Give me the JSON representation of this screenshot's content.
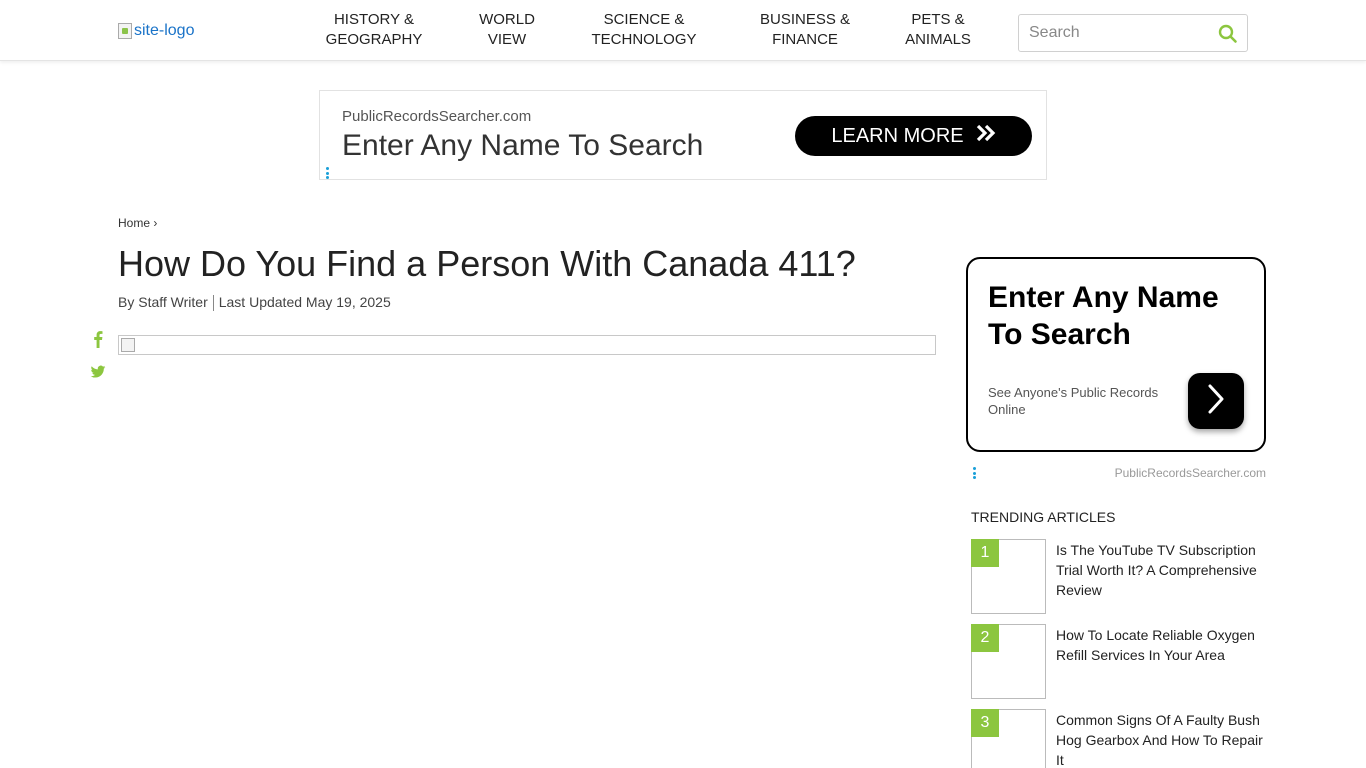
{
  "header": {
    "logo_alt": "site-logo",
    "nav": [
      {
        "line1": "HISTORY &",
        "line2": "GEOGRAPHY"
      },
      {
        "line1": "WORLD",
        "line2": "VIEW"
      },
      {
        "line1": "SCIENCE &",
        "line2": "TECHNOLOGY"
      },
      {
        "line1": "BUSINESS &",
        "line2": "FINANCE"
      },
      {
        "line1": "PETS &",
        "line2": "ANIMALS"
      }
    ],
    "search_placeholder": "Search",
    "search_icon": "search-icon"
  },
  "top_ad": {
    "domain": "PublicRecordsSearcher.com",
    "headline": "Enter Any Name To Search",
    "cta": "LEARN MORE",
    "cta_icon": "double-chevron-right-icon"
  },
  "article": {
    "breadcrumb": {
      "home": "Home",
      "sep": "›"
    },
    "title": "How Do You Find a Person With Canada 411?",
    "byline": "By Staff Writer",
    "updated": "Last Updated May 19, 2025",
    "share_icons": [
      "facebook-icon",
      "twitter-icon"
    ]
  },
  "sidebar": {
    "ad": {
      "headline": "Enter Any Name To Search",
      "sub": "See Anyone's Public Records Online",
      "domain": "PublicRecordsSearcher.com",
      "button_icon": "chevron-right-icon"
    },
    "trending": {
      "title": "TRENDING ARTICLES",
      "items": [
        {
          "num": "1",
          "text": "Is The YouTube TV Subscription Trial Worth It? A Comprehensive Review"
        },
        {
          "num": "2",
          "text": "How To Locate Reliable Oxygen Refill Services In Your Area"
        },
        {
          "num": "3",
          "text": "Common Signs Of A Faulty Bush Hog Gearbox And How To Repair It"
        }
      ]
    }
  },
  "colors": {
    "accent_green": "#8cc63f",
    "link_blue": "#1a73c8",
    "ad_dots_blue": "#1aa0d8"
  }
}
